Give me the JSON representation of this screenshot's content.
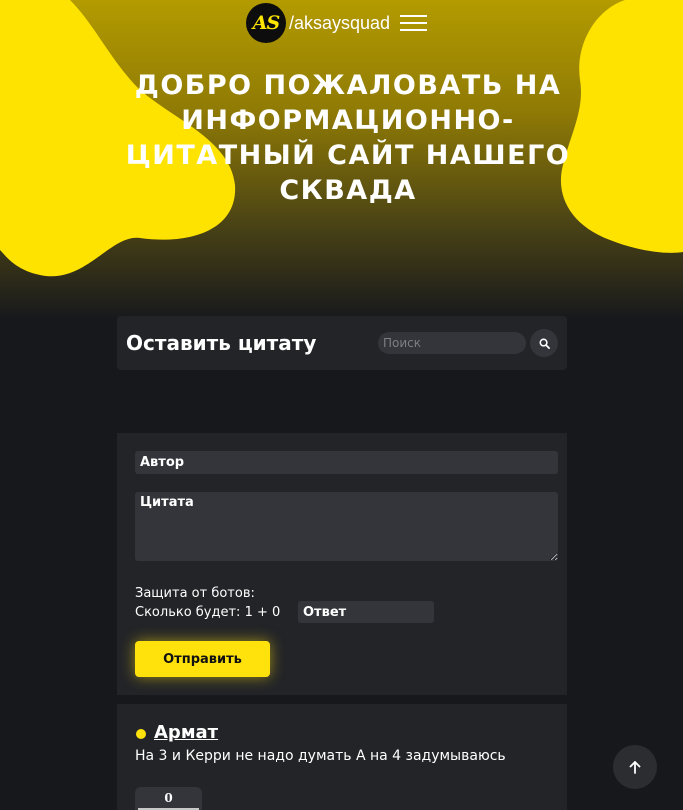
{
  "header": {
    "logo_initials": "AS",
    "logo_text": "/aksaysquad",
    "menu_icon": "hamburger-menu-icon",
    "hero_title": "Добро пожаловать на информационно-цитатный сайт нашего сквада"
  },
  "colors": {
    "accent": "#ffe20b",
    "background": "#17181c",
    "card": "#232428",
    "input": "#34353b"
  },
  "topbar": {
    "title": "Оставить цитату",
    "search_placeholder": "Поиск",
    "search_icon": "search-icon"
  },
  "form": {
    "author_placeholder": "Автор",
    "quote_placeholder": "Цитата",
    "captcha_label": "Защита от ботов:",
    "captcha_question": "Сколько будет: 1 + 0",
    "answer_placeholder": "Ответ",
    "submit_label": "Отправить"
  },
  "quotes": [
    {
      "author": "Армат",
      "text": "На 3 и Керри не надо думать А на 4 задумываюсь",
      "votes": "0"
    }
  ],
  "scroll_top_icon": "arrow-up-icon"
}
